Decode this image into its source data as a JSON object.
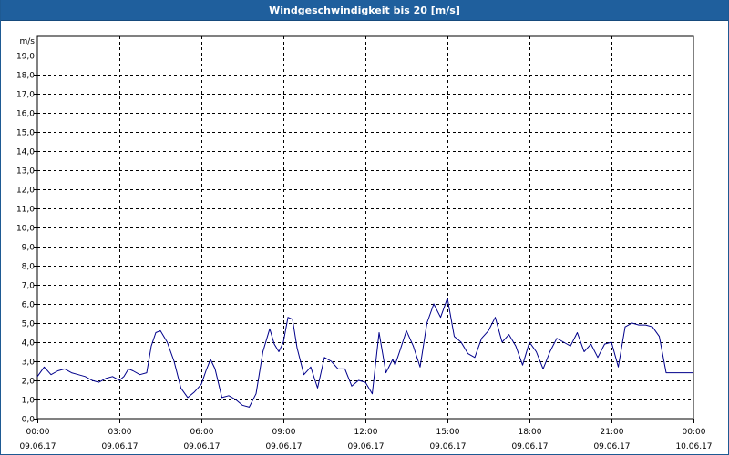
{
  "window": {
    "title": "Windgeschwindigkeit bis 20 [m/s]"
  },
  "colors": {
    "titlebar": "#1f5f9d",
    "line": "#00008b",
    "grid": "#000000"
  },
  "chart_data": {
    "type": "line",
    "title": "Windgeschwindigkeit bis 20 [m/s]",
    "ylabel": "m/s",
    "xlabel": "",
    "ylim": [
      0,
      20
    ],
    "yticks": [
      "0,0",
      "1,0",
      "2,0",
      "3,0",
      "4,0",
      "5,0",
      "6,0",
      "7,0",
      "8,0",
      "9,0",
      "10,0",
      "11,0",
      "12,0",
      "13,0",
      "14,0",
      "15,0",
      "16,0",
      "17,0",
      "18,0",
      "19,0"
    ],
    "xlim": [
      "09.06.17 00:00",
      "10.06.17 00:00"
    ],
    "xticks": [
      {
        "time": "00:00",
        "date": "09.06.17"
      },
      {
        "time": "03:00",
        "date": "09.06.17"
      },
      {
        "time": "06:00",
        "date": "09.06.17"
      },
      {
        "time": "09:00",
        "date": "09.06.17"
      },
      {
        "time": "12:00",
        "date": "09.06.17"
      },
      {
        "time": "15:00",
        "date": "09.06.17"
      },
      {
        "time": "18:00",
        "date": "09.06.17"
      },
      {
        "time": "21:00",
        "date": "09.06.17"
      },
      {
        "time": "00:00",
        "date": "10.06.17"
      }
    ],
    "grid": true,
    "grid_style": "dashed",
    "series": [
      {
        "color": "#00008b",
        "x": [
          "00:00",
          "00:15",
          "00:30",
          "00:45",
          "01:00",
          "01:15",
          "01:30",
          "01:45",
          "02:00",
          "02:15",
          "02:30",
          "02:45",
          "03:00",
          "03:10",
          "03:20",
          "03:30",
          "03:45",
          "04:00",
          "04:10",
          "04:20",
          "04:30",
          "04:45",
          "05:00",
          "05:15",
          "05:30",
          "05:45",
          "06:00",
          "06:10",
          "06:20",
          "06:30",
          "06:45",
          "07:00",
          "07:15",
          "07:30",
          "07:45",
          "08:00",
          "08:15",
          "08:30",
          "08:40",
          "08:50",
          "09:00",
          "09:10",
          "09:20",
          "09:30",
          "09:45",
          "10:00",
          "10:15",
          "10:30",
          "10:45",
          "11:00",
          "11:15",
          "11:30",
          "11:45",
          "12:00",
          "12:15",
          "12:30",
          "12:45",
          "13:00",
          "13:05",
          "13:15",
          "13:30",
          "13:45",
          "14:00",
          "14:15",
          "14:30",
          "14:45",
          "15:00",
          "15:15",
          "15:30",
          "15:45",
          "16:00",
          "16:15",
          "16:30",
          "16:45",
          "17:00",
          "17:15",
          "17:30",
          "17:45",
          "18:00",
          "18:15",
          "18:30",
          "18:45",
          "19:00",
          "19:15",
          "19:30",
          "19:45",
          "20:00",
          "20:15",
          "20:30",
          "20:45",
          "21:00",
          "21:15",
          "21:30",
          "21:45",
          "22:00",
          "22:15",
          "22:30",
          "22:45",
          "23:00",
          "23:15",
          "23:30",
          "23:45",
          "24:00"
        ],
        "y": [
          2.2,
          2.7,
          2.3,
          2.5,
          2.6,
          2.4,
          2.3,
          2.2,
          2.0,
          1.9,
          2.1,
          2.2,
          2.0,
          2.2,
          2.6,
          2.5,
          2.3,
          2.4,
          3.8,
          4.5,
          4.6,
          4.0,
          3.0,
          1.6,
          1.1,
          1.4,
          1.8,
          2.5,
          3.1,
          2.6,
          1.1,
          1.2,
          1.0,
          0.7,
          0.6,
          1.3,
          3.5,
          4.7,
          3.9,
          3.5,
          4.0,
          5.3,
          5.2,
          3.7,
          2.3,
          2.7,
          1.6,
          3.2,
          3.0,
          2.6,
          2.6,
          1.7,
          2.0,
          1.9,
          1.3,
          4.5,
          2.4,
          3.1,
          2.8,
          3.5,
          4.6,
          3.8,
          2.7,
          5.0,
          6.0,
          5.3,
          6.3,
          4.3,
          4.0,
          3.4,
          3.2,
          4.2,
          4.6,
          5.3,
          4.0,
          4.4,
          3.8,
          2.8,
          4.0,
          3.5,
          2.6,
          3.5,
          4.2,
          4.0,
          3.8,
          4.5,
          3.5,
          3.9,
          3.2,
          3.9,
          4.0,
          2.7,
          4.8,
          5.0,
          4.9,
          4.9,
          4.8,
          4.3,
          2.4,
          2.4,
          2.4,
          2.4,
          2.4
        ]
      }
    ]
  }
}
